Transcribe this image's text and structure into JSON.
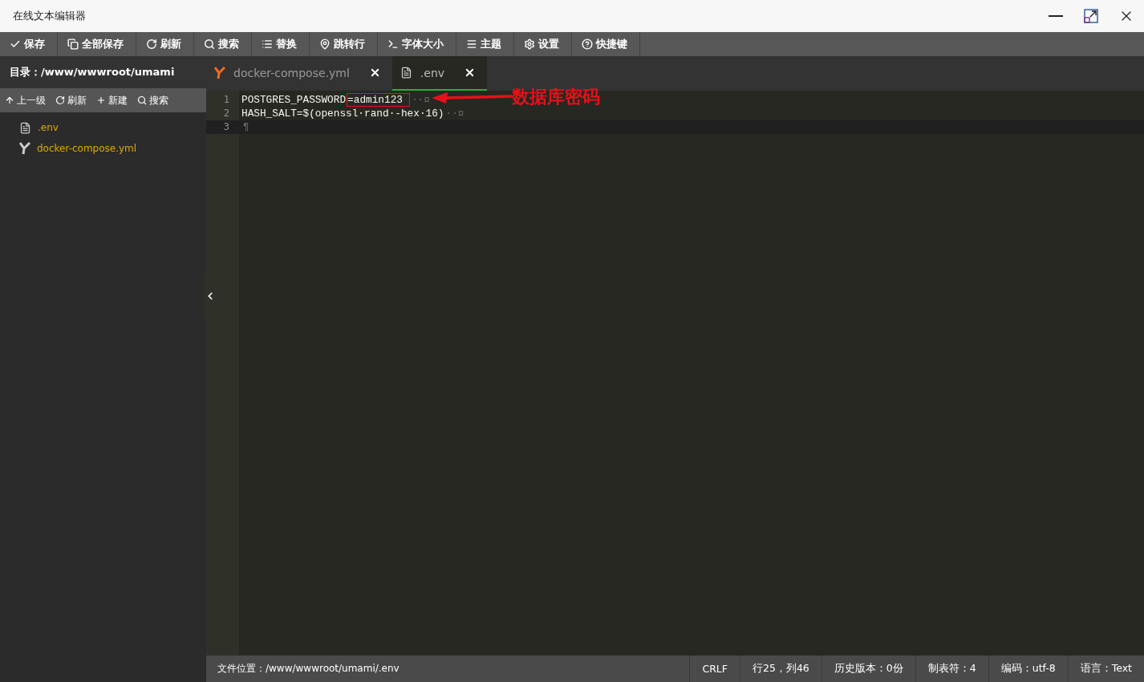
{
  "window": {
    "title": "在线文本编辑器"
  },
  "toolbar": [
    {
      "label": "保存"
    },
    {
      "label": "全部保存"
    },
    {
      "label": "刷新"
    },
    {
      "label": "搜索"
    },
    {
      "label": "替换"
    },
    {
      "label": "跳转行"
    },
    {
      "label": "字体大小"
    },
    {
      "label": "主题"
    },
    {
      "label": "设置"
    },
    {
      "label": "快捷键"
    }
  ],
  "sidebar": {
    "path_label": "目录：/www/wwwroot/umami",
    "actions": [
      {
        "label": "上一级"
      },
      {
        "label": "刷新"
      },
      {
        "label": "新建"
      },
      {
        "label": "搜索"
      }
    ],
    "files": [
      {
        "kind": "text",
        "name": ".env"
      },
      {
        "kind": "yaml",
        "name": "docker-compose.yml"
      }
    ]
  },
  "tabs": [
    {
      "kind": "yaml",
      "label": "docker-compose.yml",
      "selected": false
    },
    {
      "kind": "text",
      "label": ".env",
      "selected": true
    }
  ],
  "editor": {
    "lines": [
      {
        "number": "1",
        "selected": false,
        "segments": [
          {
            "text": "POSTGRES_PASSWORD",
            "boxed": false
          },
          {
            "text": "=admin123",
            "boxed": true
          }
        ],
        "eol": "··¤",
        "annotation": "数据库密码"
      },
      {
        "number": "2",
        "selected": false,
        "segments": [
          {
            "text": "HASH_SALT=$(openssl·rand·-hex·16)",
            "boxed": false
          }
        ],
        "eol": "··¤"
      },
      {
        "number": "3",
        "selected": true,
        "eol": "¶"
      }
    ]
  },
  "status_bar": {
    "file_path": "文件位置：/www/wwwroot/umami/.env",
    "items": [
      "CRLF",
      "行25，列46",
      "历史版本：0份",
      "制表符：4",
      "编码：utf-8",
      "语言：Text"
    ]
  }
}
